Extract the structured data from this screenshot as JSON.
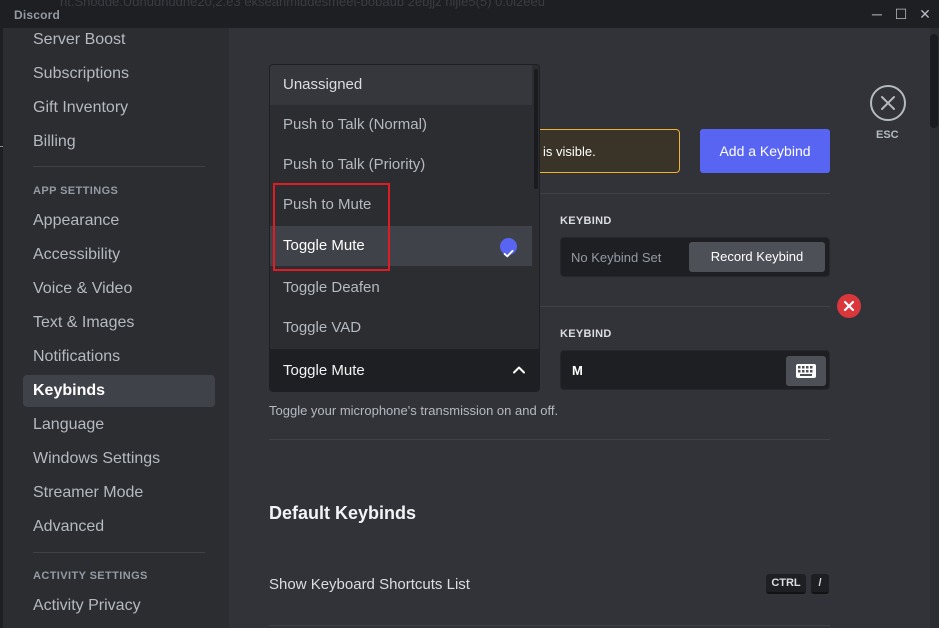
{
  "window": {
    "app_name": "Discord",
    "background_text": "nt.Shodde.Udhudhudhe20,2.e3 ekseahmiddesmeei-bobaub 2ebjjz nijle5(5) 0.0l2eeu",
    "controls": {
      "minimize": "─",
      "maximize": "☐",
      "close": "✕"
    }
  },
  "sidebar": {
    "items_top": [
      "Server Boost",
      "Subscriptions",
      "Gift Inventory",
      "Billing"
    ],
    "app_settings_header": "APP SETTINGS",
    "app_items": [
      "Appearance",
      "Accessibility",
      "Voice & Video",
      "Text & Images",
      "Notifications",
      "Keybinds",
      "Language",
      "Windows Settings",
      "Streamer Mode",
      "Advanced"
    ],
    "active_item": "Keybinds",
    "activity_header": "ACTIVITY SETTINGS",
    "activity_items": [
      "Activity Privacy"
    ]
  },
  "main": {
    "warning_text": "is visible.",
    "add_keybind_label": "Add a Keybind",
    "keybind_label_1": "KEYBIND",
    "no_keybind_text": "No Keybind Set",
    "record_keybind_label": "Record Keybind",
    "keybind_label_2": "KEYBIND",
    "keybind_value": "M",
    "description": "Toggle your microphone's transmission on and off.",
    "default_keybinds_title": "Default Keybinds",
    "shortcut_row_label": "Show Keyboard Shortcuts List",
    "shortcut_keys": [
      "CTRL",
      "/"
    ],
    "esc_label": "ESC"
  },
  "dropdown": {
    "options": [
      "Unassigned",
      "Push to Talk (Normal)",
      "Push to Talk (Priority)",
      "Push to Mute",
      "Toggle Mute",
      "Toggle Deafen",
      "Toggle VAD"
    ],
    "hovered": "Unassigned",
    "selected": "Toggle Mute",
    "current_value": "Toggle Mute"
  },
  "colors": {
    "accent": "#5865f2",
    "danger": "#da373c",
    "warning_border": "#f0b232",
    "highlight_box": "#e01b24"
  }
}
